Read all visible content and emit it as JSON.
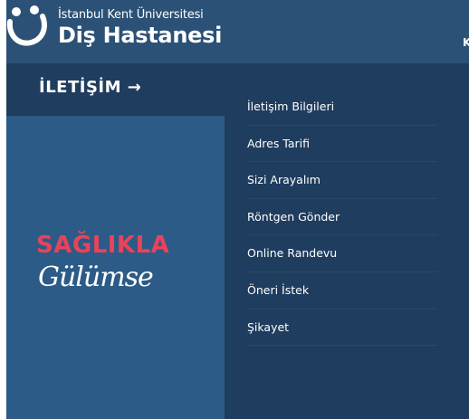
{
  "header": {
    "brand_small": "İstanbul Kent Üniversitesi",
    "brand_big": "Diş Hastanesi",
    "edge_char": "K"
  },
  "left": {
    "heading": "İLETİŞİM →",
    "slogan_line1": "SAĞLIKLA",
    "slogan_line2": "Gülümse"
  },
  "menu": {
    "items": [
      {
        "label": "İletişim Bilgileri"
      },
      {
        "label": "Adres Tarifi"
      },
      {
        "label": "Sizi Arayalım"
      },
      {
        "label": "Röntgen Gönder"
      },
      {
        "label": "Online Randevu"
      },
      {
        "label": "Öneri İstek"
      },
      {
        "label": "Şikayet"
      }
    ]
  },
  "colors": {
    "panel_dark": "#1f3d5e",
    "panel_mid": "#2b5176",
    "panel_left": "#2b5b86",
    "accent_pink": "#e8435b",
    "text": "#ffffff"
  }
}
